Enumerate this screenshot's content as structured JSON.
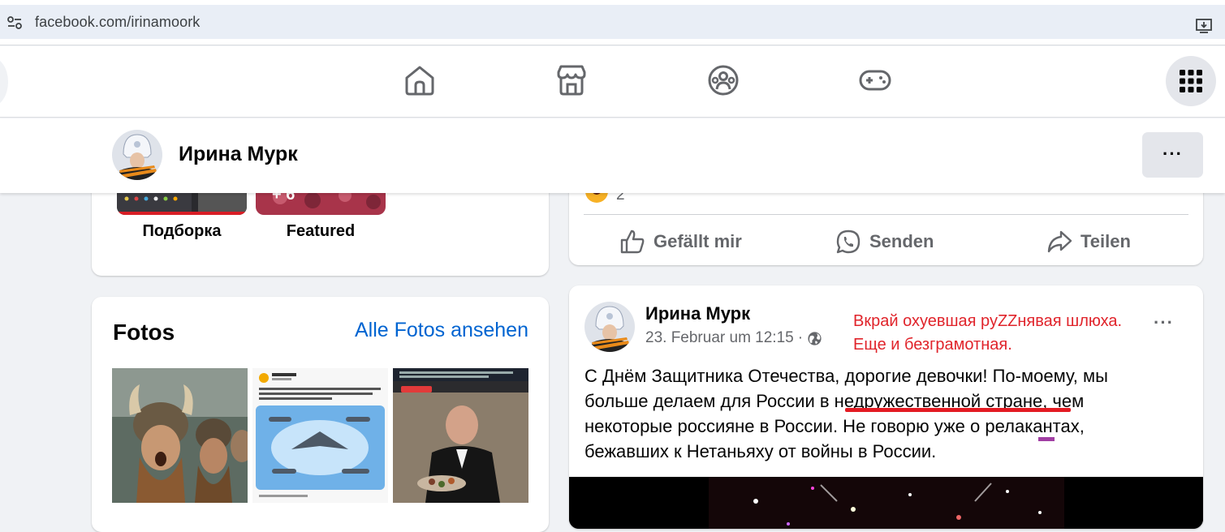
{
  "browser": {
    "url": "facebook.com/irinamoork"
  },
  "nav": {
    "tabs": [
      "home",
      "marketplace",
      "groups",
      "gaming"
    ]
  },
  "profile": {
    "name": "Ирина Мурк",
    "more": "···"
  },
  "highlights": [
    {
      "label": "Подборка"
    },
    {
      "label": "Featured",
      "badge": "+ 6"
    }
  ],
  "photos": {
    "title": "Fotos",
    "link": "Alle Fotos ansehen"
  },
  "post1": {
    "reaction_count": "2",
    "actions": [
      "Gefällt mir",
      "Senden",
      "Teilen"
    ]
  },
  "post2": {
    "author": "Ирина Мурк",
    "date": "23. Februar um 12:15",
    "separator": "·",
    "more": "···",
    "annotation_line1": "Вкрай охуевшая руZZнявая шлюха.",
    "annotation_line2": "Еще и безграмотная.",
    "text": "С Днём Защитника Отечества, дорогие девочки! По-моему, мы больше делаем  для России в недружественной стране, чем некоторые россияне в России. Не говорю уже о релакантах, бежавших к Нетаньяху от войны в России."
  },
  "colors": {
    "link": "#0064d1",
    "annotation": "#e0242b",
    "underline": "#e31b23",
    "secondary": "#65676b"
  }
}
